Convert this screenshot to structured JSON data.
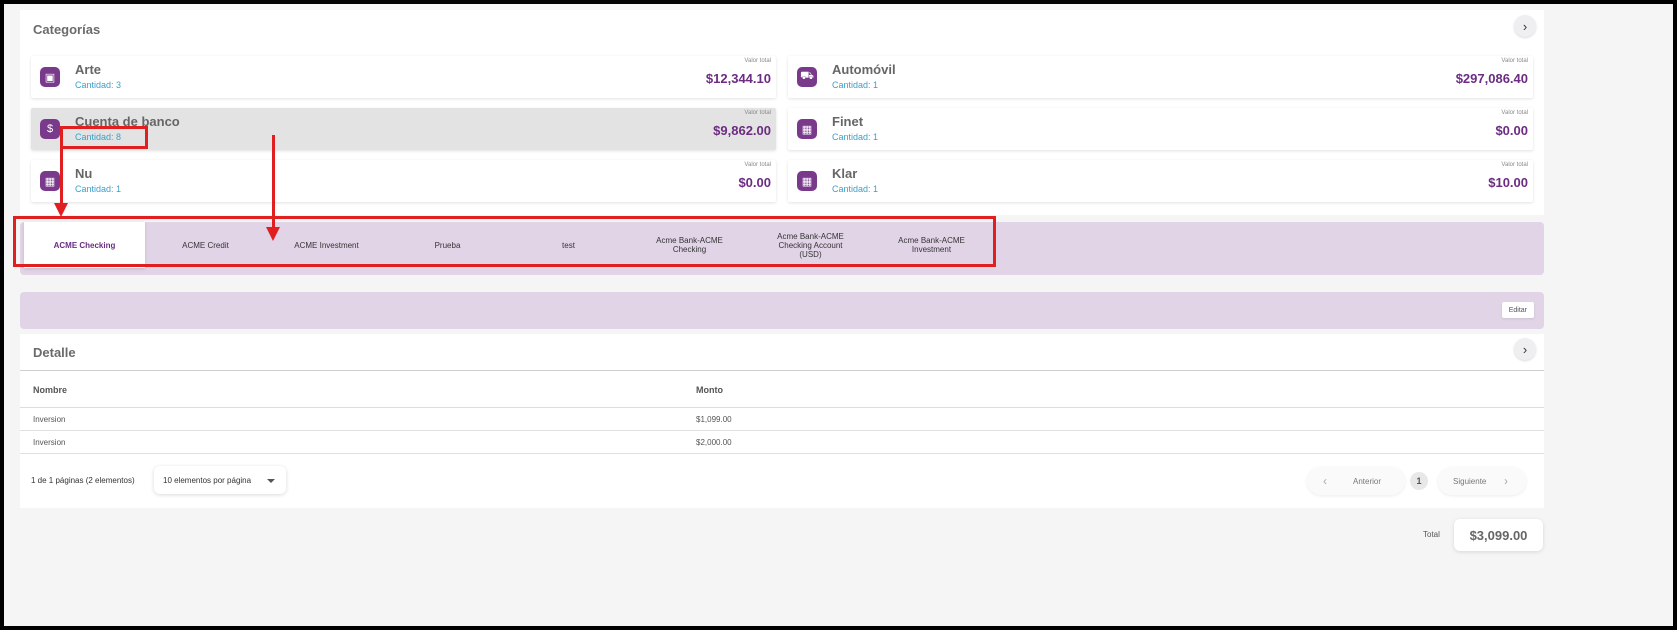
{
  "categorias": {
    "title": "Categorías",
    "expand_icon": "chevron-right-icon",
    "items": [
      {
        "name": "Arte",
        "count": "Cantidad: 3",
        "value_label": "Valor total",
        "value": "$12,344.10",
        "icon": "image-icon"
      },
      {
        "name": "Automóvil",
        "count": "Cantidad: 1",
        "value_label": "Valor total",
        "value": "$297,086.40",
        "icon": "car-icon"
      },
      {
        "name": "Cuenta de banco",
        "count": "Cantidad: 8",
        "value_label": "Valor total",
        "value": "$9,862.00",
        "icon": "bank-document-icon",
        "selected": true
      },
      {
        "name": "Finet",
        "count": "Cantidad: 1",
        "value_label": "Valor total",
        "value": "$0.00",
        "icon": "grid-icon"
      },
      {
        "name": "Nu",
        "count": "Cantidad: 1",
        "value_label": "Valor total",
        "value": "$0.00",
        "icon": "grid-icon"
      },
      {
        "name": "Klar",
        "count": "Cantidad: 1",
        "value_label": "Valor total",
        "value": "$10.00",
        "icon": "grid-icon"
      }
    ]
  },
  "tabs": [
    {
      "label": "ACME Checking",
      "active": true
    },
    {
      "label": "ACME Credit"
    },
    {
      "label": "ACME Investment"
    },
    {
      "label": "Prueba"
    },
    {
      "label": "test"
    },
    {
      "label": "Acme Bank-ACME Checking"
    },
    {
      "label": "Acme Bank-ACME Checking Account (USD)"
    },
    {
      "label": "Acme Bank-ACME Investment"
    }
  ],
  "toolbar": {
    "edit_label": "Editar"
  },
  "detalle": {
    "title": "Detalle",
    "columns": [
      "Nombre",
      "Monto"
    ],
    "rows": [
      {
        "nombre": "Inversion",
        "monto": "$1,099.00"
      },
      {
        "nombre": "Inversion",
        "monto": "$2,000.00"
      }
    ],
    "pagination": {
      "summary": "1 de 1 páginas (2 elementos)",
      "per_page": "10 elementos por página",
      "prev": "Anterior",
      "page": "1",
      "next": "Siguiente"
    },
    "total_label": "Total",
    "total_value": "$3,099.00"
  },
  "colors": {
    "accent": "#6b2c82",
    "tab_bar": "#e1d4e7",
    "annotation": "#e02020",
    "count_text": "#3ba0c8"
  }
}
